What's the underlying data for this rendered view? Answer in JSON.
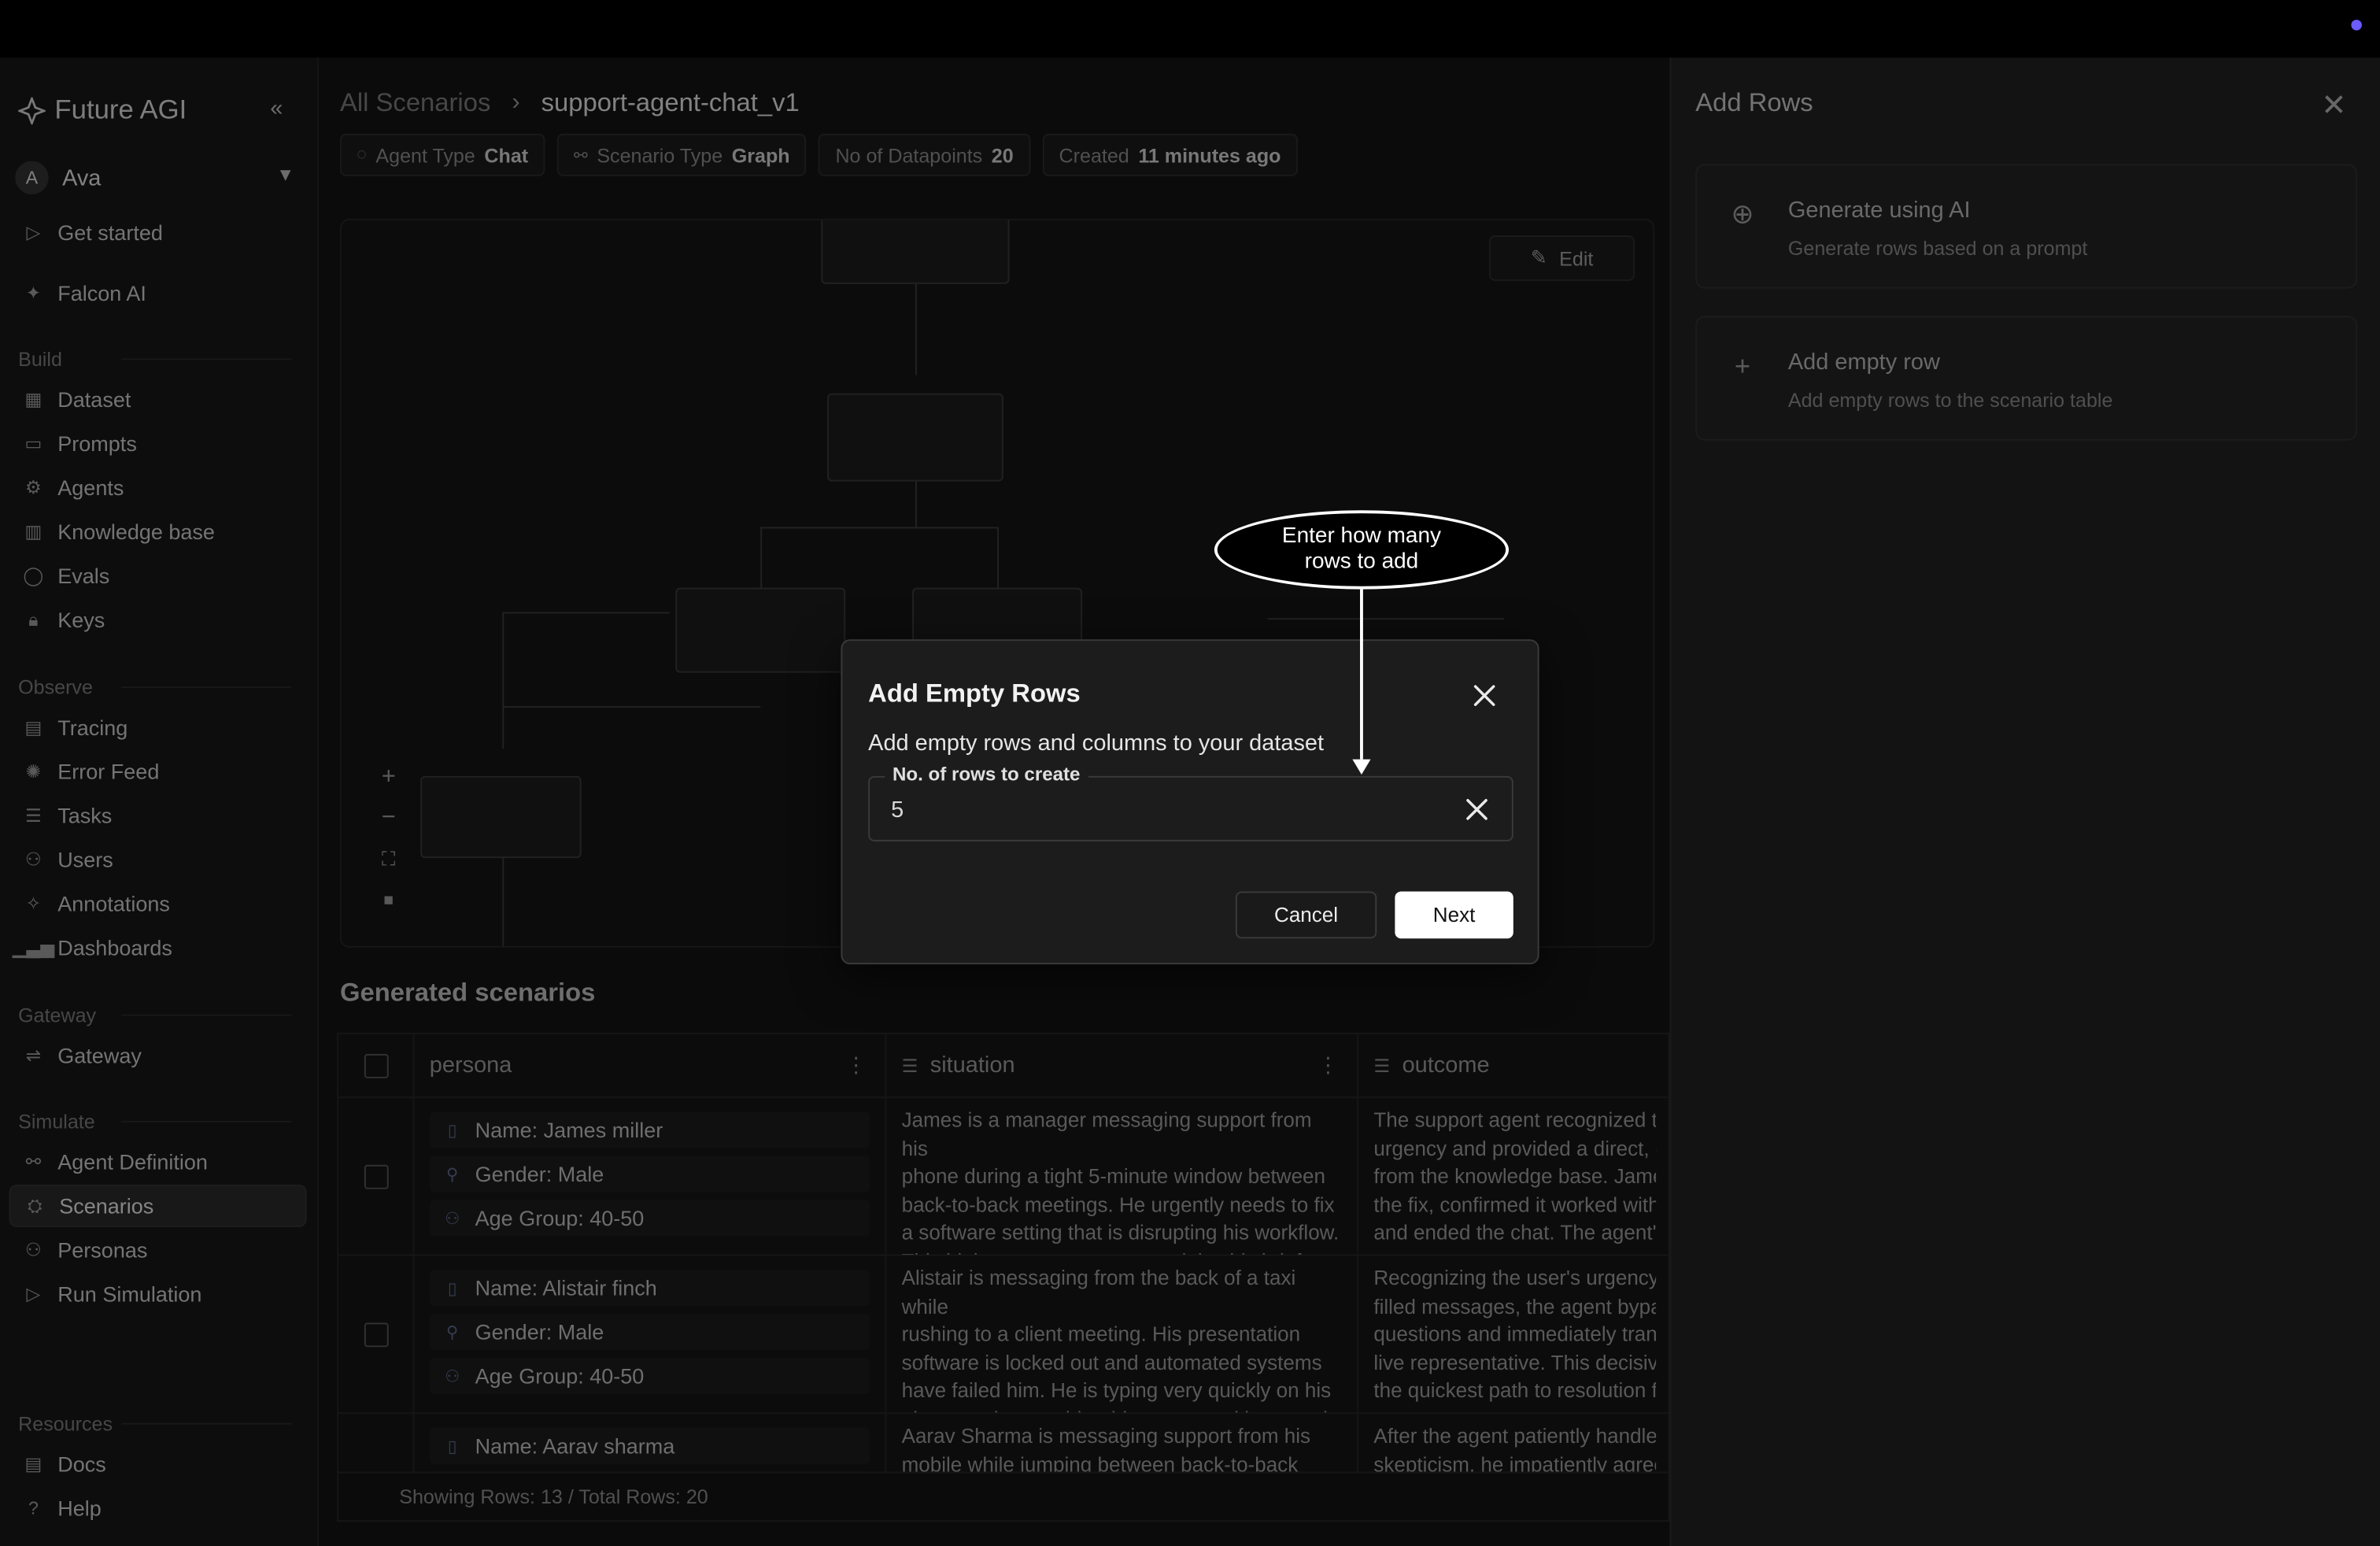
{
  "sidebar": {
    "brand": "Future AGI",
    "user": {
      "initial": "A",
      "name": "Ava"
    },
    "top_items": [
      {
        "label": "Get started",
        "icon": "play-icon"
      },
      {
        "label": "Falcon AI",
        "icon": "falcon-icon"
      }
    ],
    "sections": [
      {
        "title": "Build",
        "items": [
          "Dataset",
          "Prompts",
          "Agents",
          "Knowledge base",
          "Evals",
          "Keys"
        ]
      },
      {
        "title": "Observe",
        "items": [
          "Tracing",
          "Error Feed",
          "Tasks",
          "Users",
          "Annotations",
          "Dashboards"
        ]
      },
      {
        "title": "Gateway",
        "items": [
          "Gateway"
        ]
      },
      {
        "title": "Simulate",
        "items": [
          "Agent Definition",
          "Scenarios",
          "Personas",
          "Run Simulation"
        ]
      },
      {
        "title": "Resources",
        "items": [
          "Docs",
          "Help"
        ]
      }
    ],
    "active": "Scenarios"
  },
  "header": {
    "breadcrumb_root": "All Scenarios",
    "breadcrumb_current": "support-agent-chat_v1",
    "chips": [
      {
        "label": "Agent Type",
        "value": "Chat"
      },
      {
        "label": "Scenario Type",
        "value": "Graph"
      },
      {
        "label": "No of Datapoints",
        "value": "20"
      },
      {
        "label": "Created",
        "value": "11 minutes ago"
      }
    ]
  },
  "canvas": {
    "edit_label": "Edit"
  },
  "generated": {
    "title": "Generated scenarios",
    "columns": [
      "persona",
      "situation",
      "outcome"
    ],
    "rows": [
      {
        "name": "Name: James miller",
        "gender": "Gender: Male",
        "age": "Age Group: 40-50",
        "situation": [
          "James is a manager messaging support from his",
          "phone during a tight 5-minute window between",
          "back-to-back meetings. He urgently needs to fix",
          "a software setting that is disrupting his workflow.",
          "This high-pressure context explains his brief,"
        ],
        "outcome": [
          "The support agent recognized th",
          "urgency and provided a direct, ef",
          "from the knowledge base. James",
          "the fix, confirmed it worked with",
          "and ended the chat. The agent's"
        ]
      },
      {
        "name": "Name: Alistair finch",
        "gender": "Gender: Male",
        "age": "Age Group: 40-50",
        "situation": [
          "Alistair is messaging from the back of a taxi while",
          "rushing to a client meeting. His presentation",
          "software is locked out and automated systems",
          "have failed him. He is typing very quickly on his",
          "phone under considerable stress and is urgently"
        ],
        "outcome": [
          "Recognizing the user's urgency f",
          "filled messages, the agent bypas",
          "questions and immediately transf",
          "live representative. This decisive",
          "the quickest path to resolution fo"
        ]
      },
      {
        "name": "Name: Aarav sharma",
        "gender": "",
        "age": "",
        "situation": [
          "Aarav Sharma is messaging support from his",
          "mobile while jumping between back-to-back"
        ],
        "outcome": [
          "After the agent patiently handled",
          "skepticism, he impatiently agree"
        ]
      }
    ],
    "footer": "Showing Rows: 13 / Total Rows: 20"
  },
  "panel": {
    "title": "Add Rows",
    "options": [
      {
        "title": "Generate using AI",
        "subtitle": "Generate rows based on a prompt",
        "icon": "plus-circle-icon"
      },
      {
        "title": "Add empty row",
        "subtitle": "Add empty rows to the scenario table",
        "icon": "plus-icon"
      }
    ]
  },
  "modal": {
    "title": "Add Empty Rows",
    "description": "Add empty rows and columns to your dataset",
    "field_label": "No. of rows to create",
    "field_value": "5",
    "cancel_label": "Cancel",
    "next_label": "Next"
  },
  "annotation": {
    "text_line1": "Enter how many",
    "text_line2": "rows to add"
  },
  "colors": {
    "accent": "#6b5cff",
    "background": "#121212",
    "primary_button": "#ffffff"
  }
}
